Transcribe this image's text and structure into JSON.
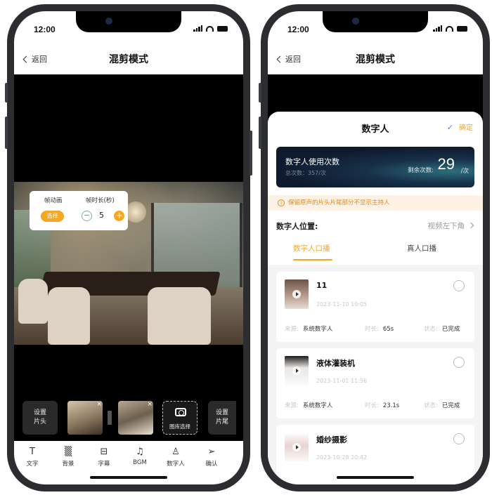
{
  "status": {
    "time": "12:00"
  },
  "left_phone": {
    "nav": {
      "back_label": "返回",
      "title": "混剪模式"
    },
    "overlay": {
      "frame_anim_label": "帧动画",
      "frame_duration_label": "帧时长(秒)",
      "select_label": "选择",
      "minus": "−",
      "value": "5",
      "plus": "+"
    },
    "clips": {
      "set_head_label": "设置\n片头",
      "set_tail_label": "设置\n片尾",
      "close_icon": "×",
      "gallery_label": "图库选择"
    },
    "toolbar": [
      {
        "label": "文字",
        "icon": "text-icon",
        "glyph": "T"
      },
      {
        "label": "背景",
        "icon": "background-icon",
        "glyph": "▒"
      },
      {
        "label": "字幕",
        "icon": "subtitle-icon",
        "glyph": "⊟"
      },
      {
        "label": "BGM",
        "icon": "music-icon",
        "glyph": "♫"
      },
      {
        "label": "数字人",
        "icon": "digital-human-icon",
        "glyph": "♙"
      },
      {
        "label": "确认",
        "icon": "send-icon",
        "glyph": "➢"
      }
    ]
  },
  "right_phone": {
    "nav": {
      "back_label": "返回",
      "title": "混剪模式"
    },
    "sheet": {
      "title": "数字人",
      "confirm_check": "✓",
      "confirm_label": "确定",
      "usage": {
        "title": "数字人使用次数",
        "total": "总次数：357/次",
        "remaining_label": "剩余次数:",
        "remaining_value": "29",
        "unit": "/次"
      },
      "notice_icon": "!",
      "notice": "保留原声的片头片尾部分不显示主持人",
      "position_label": "数字人位置:",
      "position_value": "视频左下角",
      "tabs": [
        "数字人口播",
        "真人口播"
      ],
      "active_tab": 0,
      "items": [
        {
          "name": "11",
          "date": "2023-11-10 10:05",
          "source_label": "来源:",
          "source": "系统数字人",
          "duration_label": "时长:",
          "duration": "65s",
          "status_label": "状态:",
          "status": "已完成"
        },
        {
          "name": "液体灌装机",
          "date": "2023-11-01 11:56",
          "source_label": "来源:",
          "source": "系统数字人",
          "duration_label": "时长:",
          "duration": "23.1s",
          "status_label": "状态:",
          "status": "已完成"
        },
        {
          "name": "婚纱摄影",
          "date": "2023-10-28 20:42"
        }
      ]
    }
  }
}
